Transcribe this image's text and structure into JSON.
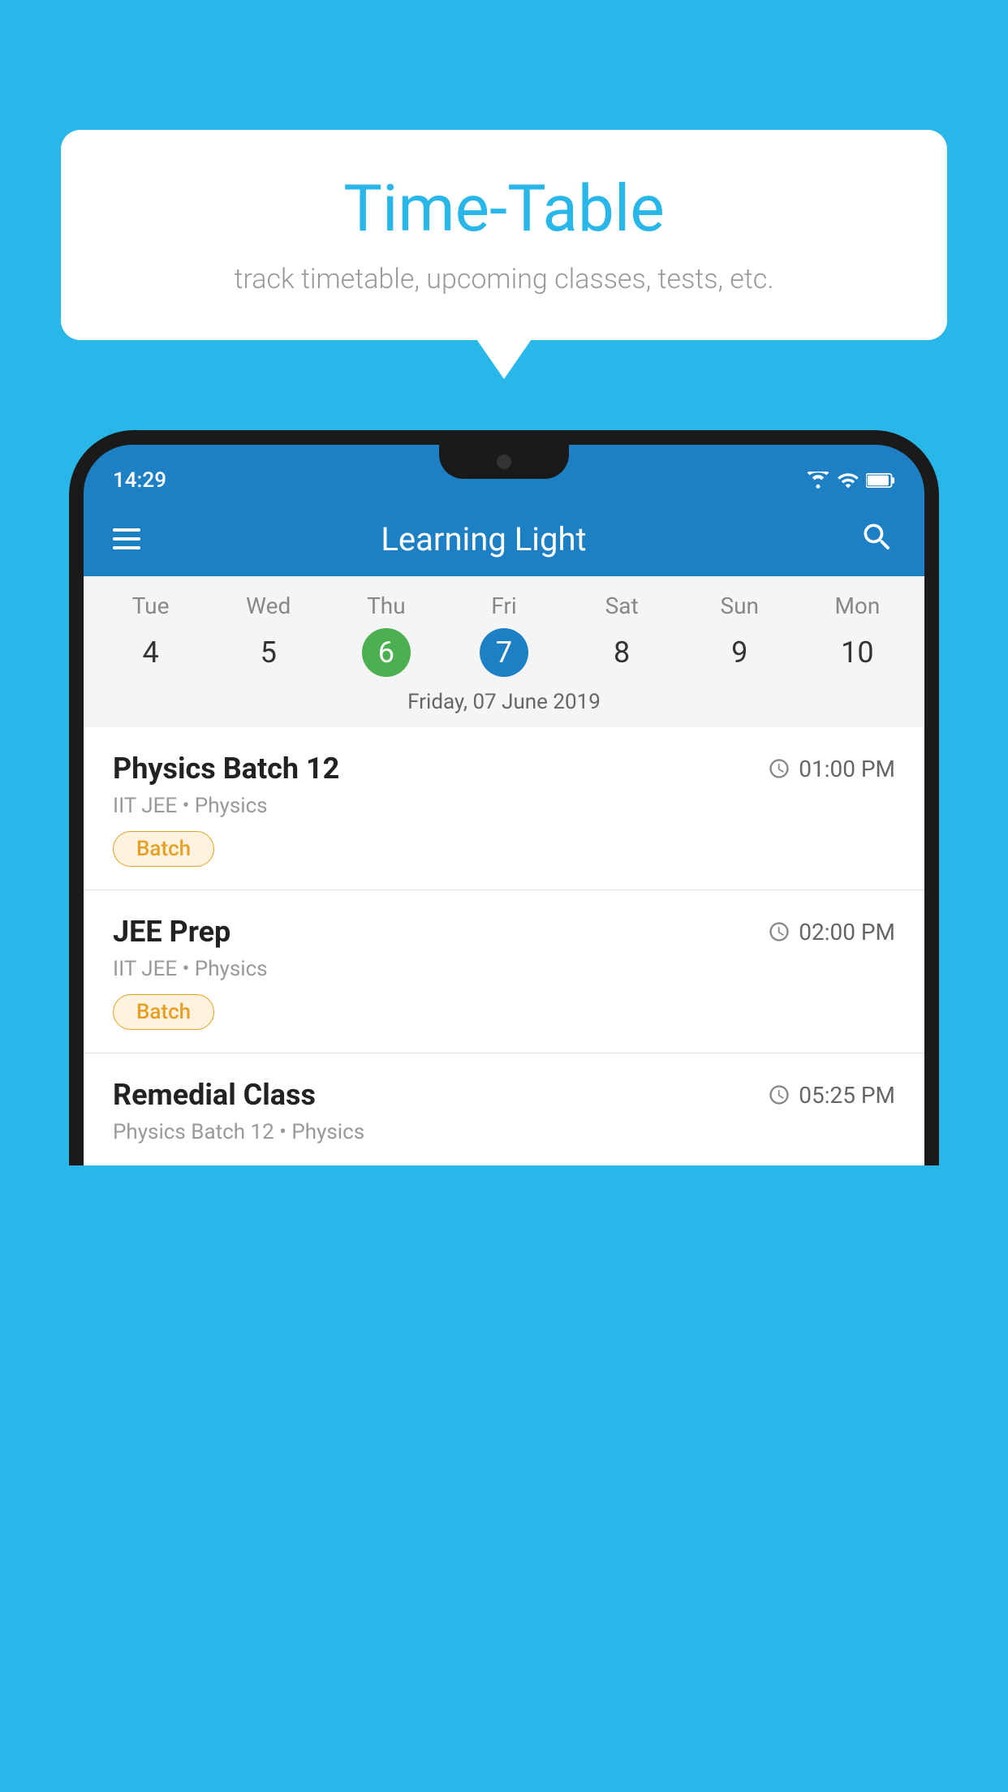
{
  "background_color": "#29b6e8",
  "bubble": {
    "title": "Time-Table",
    "subtitle": "track timetable, upcoming classes, tests, etc."
  },
  "status_bar": {
    "time": "14:29"
  },
  "app_header": {
    "title": "Learning Light"
  },
  "calendar": {
    "days": [
      "Tue",
      "Wed",
      "Thu",
      "Fri",
      "Sat",
      "Sun",
      "Mon"
    ],
    "numbers": [
      "4",
      "5",
      "6",
      "7",
      "8",
      "9",
      "10"
    ],
    "today_index": 2,
    "selected_index": 3,
    "selected_date_label": "Friday, 07 June 2019"
  },
  "schedule": [
    {
      "title": "Physics Batch 12",
      "time": "01:00 PM",
      "sub": "IIT JEE • Physics",
      "tag": "Batch"
    },
    {
      "title": "JEE Prep",
      "time": "02:00 PM",
      "sub": "IIT JEE • Physics",
      "tag": "Batch"
    },
    {
      "title": "Remedial Class",
      "time": "05:25 PM",
      "sub": "Physics Batch 12 • Physics",
      "tag": null
    }
  ],
  "icons": {
    "hamburger": "☰",
    "search": "🔍",
    "clock": "clock"
  }
}
